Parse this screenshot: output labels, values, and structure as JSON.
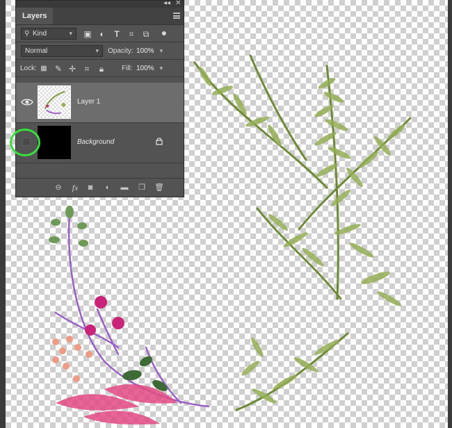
{
  "panel": {
    "title": "Layers",
    "filter": {
      "icon": "search-icon",
      "value": "Kind"
    },
    "blend_mode": "Normal",
    "opacity_label": "Opacity:",
    "opacity_value": "100%",
    "lock_label": "Lock:",
    "fill_label": "Fill:",
    "fill_value": "100%"
  },
  "layers": [
    {
      "name": "Layer 1",
      "visible": true,
      "selected": true
    },
    {
      "name": "Background",
      "visible": false,
      "locked": true
    }
  ],
  "colors": {
    "panel_bg": "#535353",
    "selected_layer": "#6d6d6d",
    "highlight_circle": "#37e03c",
    "fern_green": "#7d9a3e",
    "purple_stem": "#9b5fc8",
    "magenta_berry": "#c8257a",
    "peach_berry": "#ee9b86",
    "pink_leaf": "#e24b84"
  }
}
